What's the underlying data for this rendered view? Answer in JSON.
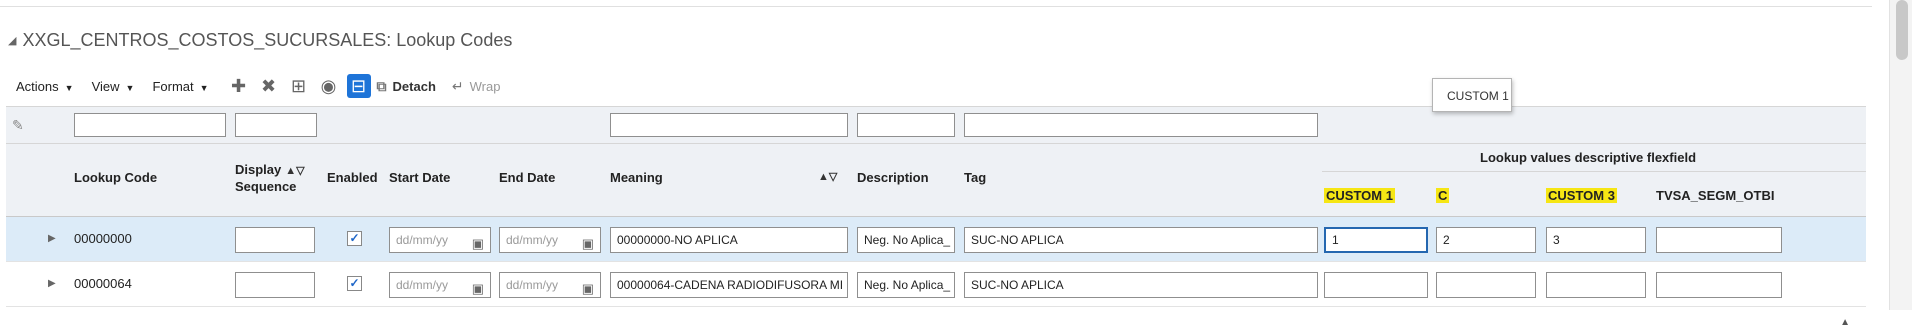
{
  "title": "XXGL_CENTROS_COSTOS_SUCURSALES: Lookup Codes",
  "toolbar": {
    "actions": "Actions",
    "view": "View",
    "format": "Format",
    "detach": "Detach",
    "wrap": "Wrap"
  },
  "columns": {
    "lookup_code": "Lookup Code",
    "display_seq_1": "Display",
    "display_seq_2": "Sequence",
    "enabled": "Enabled",
    "start_date": "Start Date",
    "end_date": "End Date",
    "meaning": "Meaning",
    "description": "Description",
    "tag": "Tag",
    "flexfield_group": "Lookup values descriptive flexfield",
    "custom1": "CUSTOM 1",
    "custom2": "C",
    "custom3": "CUSTOM 3",
    "tvsa": "TVSA_SEGM_OTBI"
  },
  "tooltip": "CUSTOM 1",
  "date_placeholder": "dd/mm/yy",
  "rows": [
    {
      "lookup_code": "00000000",
      "display_sequence": "",
      "enabled": true,
      "meaning": "00000000-NO APLICA",
      "description": "Neg. No Aplica_",
      "tag": "SUC-NO APLICA",
      "custom1": "1",
      "custom2": "2",
      "custom3": "3",
      "tvsa": ""
    },
    {
      "lookup_code": "00000064",
      "display_sequence": "",
      "enabled": true,
      "meaning": "00000064-CADENA RADIODIFUSORA MI",
      "description": "Neg. No Aplica_",
      "tag": "SUC-NO APLICA",
      "custom1": "",
      "custom2": "",
      "custom3": "",
      "tvsa": ""
    }
  ]
}
